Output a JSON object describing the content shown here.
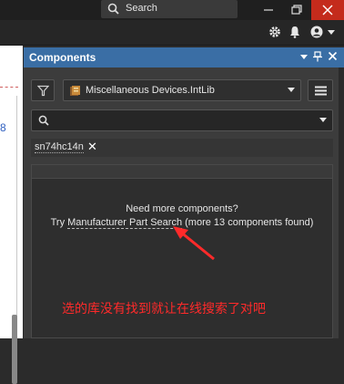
{
  "titlebar": {
    "search_label": "Search",
    "buttons": [
      "minimize",
      "maximize",
      "close"
    ]
  },
  "toolbar": {
    "icons": [
      "gear-icon",
      "bell-icon",
      "user-icon"
    ]
  },
  "editor": {
    "partial_digit": "8"
  },
  "panel": {
    "title": "Components",
    "library": "Miscellaneous Devices.IntLib",
    "search_value": "",
    "filter_chip": "sn74hc14n",
    "results": {
      "need_more": "Need more components?",
      "try_prefix": "Try ",
      "link_text": "Manufacturer Part Search",
      "found_text": " (more 13 components found)"
    }
  },
  "annotation": {
    "text": "选的库没有找到就让在线搜索了对吧",
    "color": "#ff2a2a"
  },
  "colors": {
    "accent_header": "#3a6ea5",
    "close_button": "#c42b1c",
    "panel_bg": "#3c3c3c"
  }
}
